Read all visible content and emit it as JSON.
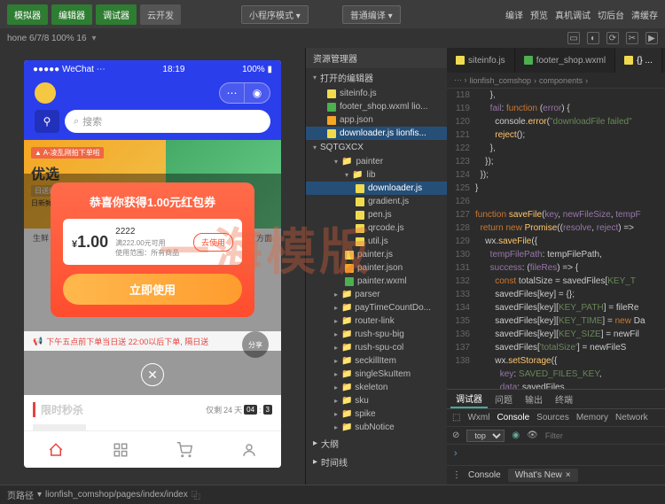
{
  "toolbar": {
    "buttons": [
      "模拟器",
      "编辑器",
      "调试器",
      "云开发"
    ],
    "mode_dropdown": "小程序模式",
    "compile_dropdown": "普通编译",
    "right_actions": [
      "编译",
      "预览",
      "真机调试",
      "切后台",
      "清缓存"
    ]
  },
  "device_bar": {
    "device": "hone 6/7/8 100% 16"
  },
  "phone": {
    "status": {
      "carrier": "WeChat",
      "time": "18:19",
      "battery": "100%"
    },
    "search_placeholder": "搜索",
    "banner": {
      "tag": "A-凌乱刚拍下单啦",
      "line1": "优选",
      "line2": "日送达",
      "line3": "日新鲜"
    },
    "coupon": {
      "title": "恭喜你获得1.00元红包券",
      "amount": "1.00",
      "name": "2222",
      "cond": "满222.00元可用",
      "scope": "使用范围：所有商品",
      "get_btn": "去使用",
      "use_btn": "立即使用"
    },
    "notice": "下午五点前下单当日送 22:00以后下单, 隔日送",
    "share": "分享",
    "seckill": {
      "title": "限时秒杀",
      "remain_label": "仅剩",
      "days": "24",
      "days_unit": "天",
      "t1": "04",
      "t2": "3"
    }
  },
  "path_bar": {
    "label": "页路径",
    "path": "lionfish_comshop/pages/index/index"
  },
  "tree": {
    "title": "资源管理器",
    "open_editors": "打开的编辑器",
    "open_files": [
      {
        "icon": "js",
        "name": "siteinfo.js"
      },
      {
        "icon": "wxml",
        "name": "footer_shop.wxml lio..."
      },
      {
        "icon": "json",
        "name": "app.json"
      },
      {
        "icon": "js",
        "name": "downloader.js lionfis...",
        "active": true
      }
    ],
    "project": "SQTGXCX",
    "folders": [
      {
        "name": "painter",
        "level": 1,
        "open": true
      },
      {
        "name": "lib",
        "level": 2,
        "open": true
      }
    ],
    "lib_files": [
      {
        "icon": "js",
        "name": "downloader.js",
        "active": true
      },
      {
        "icon": "js",
        "name": "gradient.js"
      },
      {
        "icon": "js",
        "name": "pen.js"
      },
      {
        "icon": "js",
        "name": "qrcode.js"
      },
      {
        "icon": "js",
        "name": "util.js"
      }
    ],
    "painter_files": [
      {
        "icon": "js",
        "name": "painter.js"
      },
      {
        "icon": "json",
        "name": "painter.json"
      },
      {
        "icon": "wxml",
        "name": "painter.wxml"
      }
    ],
    "other_folders": [
      "parser",
      "payTimeCountDo...",
      "router-link",
      "rush-spu-big",
      "rush-spu-col",
      "seckillItem",
      "singleSkuItem",
      "skeleton",
      "sku",
      "spike",
      "subNotice"
    ],
    "outline": "大纲",
    "timeline": "时间线"
  },
  "editor": {
    "tabs": [
      {
        "icon": "js",
        "name": "siteinfo.js"
      },
      {
        "icon": "wxml",
        "name": "footer_shop.wxml"
      }
    ],
    "breadcrumb": [
      "lionfish_comshop",
      "components"
    ],
    "gutter_start": 118,
    "gutter_count": 34
  },
  "devtools": {
    "top_tabs": [
      "调试器",
      "问题",
      "输出",
      "终端"
    ],
    "sub_tabs": [
      "Wxml",
      "Console",
      "Sources",
      "Memory",
      "Network"
    ],
    "filter_level": "top",
    "filter_placeholder": "Filter",
    "bottom": {
      "console": "Console",
      "whatsnew": "What's New"
    }
  },
  "watermark": "一海模版"
}
